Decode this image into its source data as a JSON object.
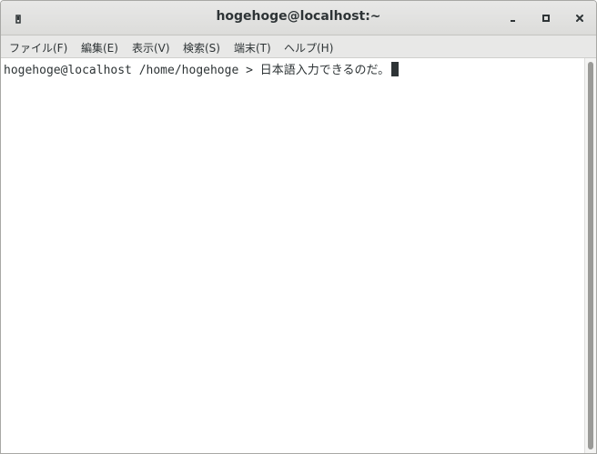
{
  "window": {
    "title": "hogehoge@localhost:~",
    "icon": "terminal-pin-icon",
    "controls": {
      "minimize": "minimize-icon",
      "maximize": "maximize-icon",
      "close": "close-icon"
    }
  },
  "menubar": {
    "items": [
      {
        "label": "ファイル(F)"
      },
      {
        "label": "編集(E)"
      },
      {
        "label": "表示(V)"
      },
      {
        "label": "検索(S)"
      },
      {
        "label": "端末(T)"
      },
      {
        "label": "ヘルプ(H)"
      }
    ]
  },
  "terminal": {
    "prompt": "hogehoge@localhost /home/hogehoge > ",
    "input": "日本語入力できるのだ。"
  },
  "colors": {
    "titlebar": "#dcdcda",
    "menubar": "#e8e8e7",
    "text": "#2e3436",
    "background": "#ffffff",
    "scroll_thumb": "#9a9a97"
  }
}
